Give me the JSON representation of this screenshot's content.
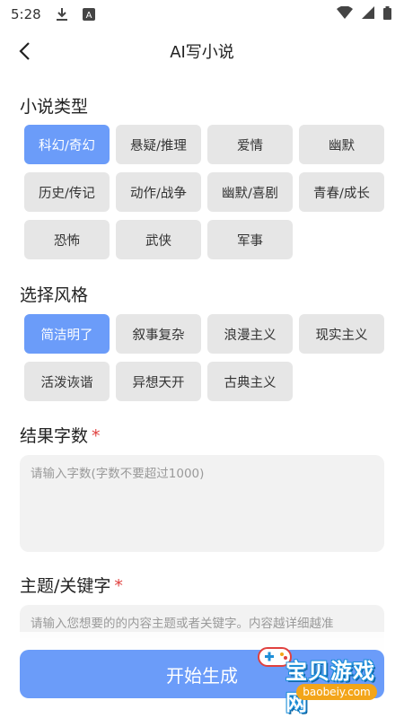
{
  "status_bar": {
    "time": "5:28",
    "icons": [
      "download-icon",
      "app-a-icon",
      "wifi-icon",
      "signal-icon",
      "battery-icon"
    ],
    "app_badge": "A"
  },
  "header": {
    "title": "AI写小说",
    "back_icon": "chevron-left-icon"
  },
  "genre": {
    "label": "小说类型",
    "selected": "科幻/奇幻",
    "options": [
      "科幻/奇幻",
      "悬疑/推理",
      "爱情",
      "幽默",
      "历史/传记",
      "动作/战争",
      "幽默/喜剧",
      "青春/成长",
      "恐怖",
      "武侠",
      "军事"
    ]
  },
  "style": {
    "label": "选择风格",
    "selected": "简洁明了",
    "options": [
      "简洁明了",
      "叙事复杂",
      "浪漫主义",
      "现实主义",
      "活泼诙谐",
      "异想天开",
      "古典主义"
    ]
  },
  "word_count": {
    "label": "结果字数",
    "required_mark": "*",
    "placeholder": "请输入字数(字数不要超过1000)"
  },
  "topic": {
    "label": "主题/关键字",
    "required_mark": "*",
    "placeholder": "请输入您想要的的内容主题或者关键字。内容越详细越准"
  },
  "start_button": "开始生成",
  "watermark": {
    "text": "宝贝游戏网",
    "url": "baobeiy.com"
  },
  "colors": {
    "accent": "#6b9cf9",
    "chip_bg": "#e6e6e6",
    "required": "#e0413f"
  }
}
